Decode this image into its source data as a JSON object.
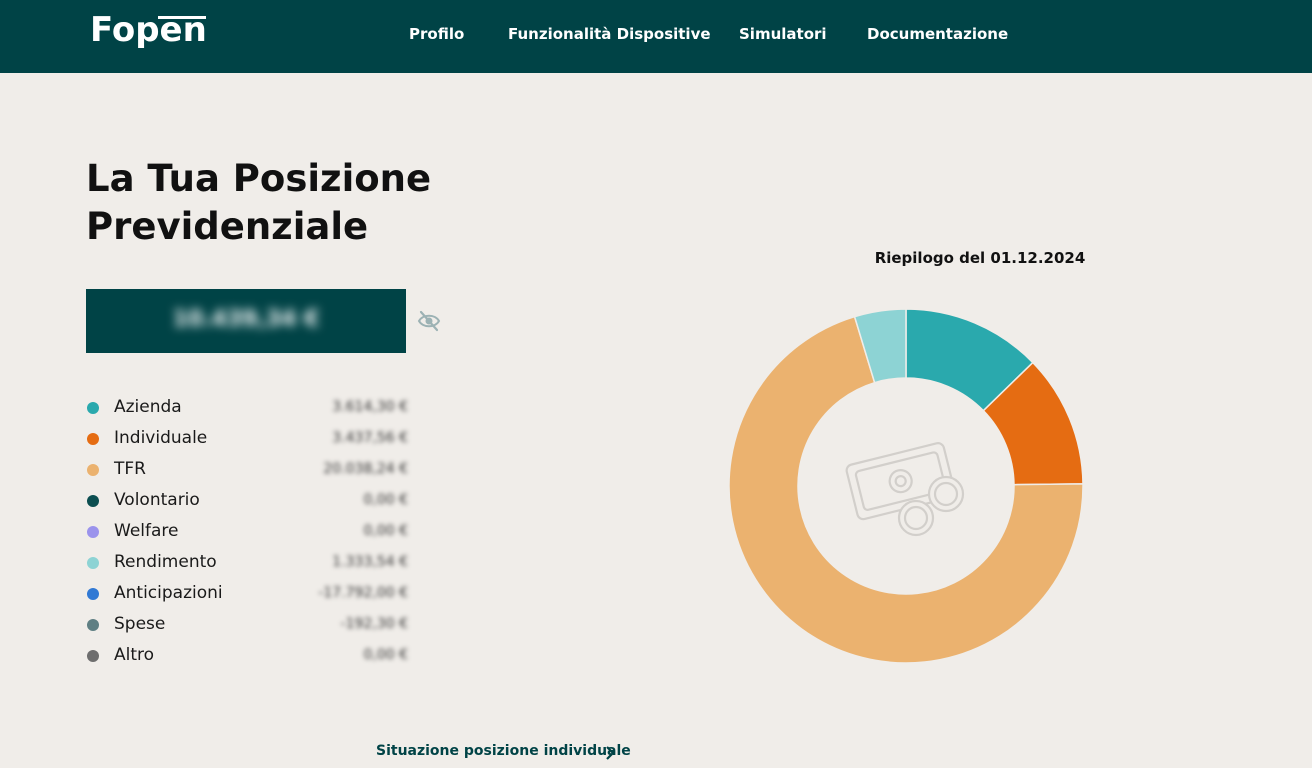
{
  "header": {
    "logo_text": "Fopen",
    "nav": [
      {
        "label": "Profilo"
      },
      {
        "label": "Funzionalità Dispositive"
      },
      {
        "label": "Simulatori"
      },
      {
        "label": "Documentazione"
      }
    ]
  },
  "main": {
    "title": "La Tua Posizione Previdenziale",
    "total_value": "10.439,34 €",
    "visibility_icon": "eye-slash-icon",
    "legend": [
      {
        "label": "Azienda",
        "value": "3.614,30 €",
        "color": "#2aa9ad"
      },
      {
        "label": "Individuale",
        "value": "3.437,56 €",
        "color": "#e56c12"
      },
      {
        "label": "TFR",
        "value": "20.038,24 €",
        "color": "#ebb26f"
      },
      {
        "label": "Volontario",
        "value": "0,00 €",
        "color": "#0c4e50"
      },
      {
        "label": "Welfare",
        "value": "0,00 €",
        "color": "#9b93ec"
      },
      {
        "label": "Rendimento",
        "value": "1.333,54 €",
        "color": "#8dd3d4"
      },
      {
        "label": "Anticipazioni",
        "value": "-17.792,00 €",
        "color": "#3179d4"
      },
      {
        "label": "Spese",
        "value": "-192,30 €",
        "color": "#5f7f83"
      },
      {
        "label": "Altro",
        "value": "0,00 €",
        "color": "#6e6e6e"
      }
    ],
    "link_label": "Situazione posizione individuale",
    "link_icon": "chevron-right-icon"
  },
  "chart_data": {
    "type": "pie",
    "title": "Riepilogo del 01.12.2024",
    "donut": true,
    "center_icon": "money-icon",
    "slices": [
      {
        "label": "Azienda",
        "value": 3614.3,
        "color": "#2aa9ad"
      },
      {
        "label": "Individuale",
        "value": 3437.56,
        "color": "#e56c12"
      },
      {
        "label": "TFR",
        "value": 20038.24,
        "color": "#ebb26f"
      },
      {
        "label": "Rendimento",
        "value": 1333.54,
        "color": "#8dd3d4"
      }
    ]
  }
}
